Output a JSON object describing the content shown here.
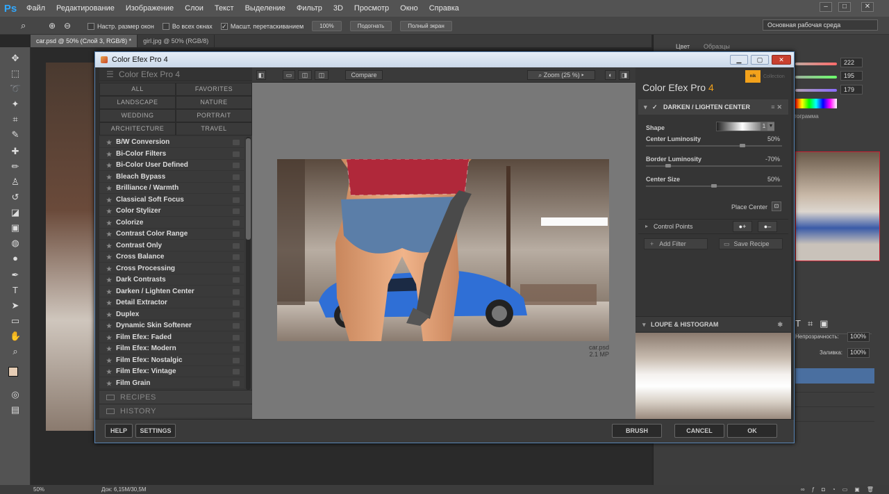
{
  "photoshop": {
    "app_logo": "Ps",
    "menu": [
      "Файл",
      "Редактирование",
      "Изображение",
      "Слои",
      "Текст",
      "Выделение",
      "Фильтр",
      "3D",
      "Просмотр",
      "Окно",
      "Справка"
    ],
    "options": {
      "resize_windows": "Настр. размер окон",
      "all_windows": "Во всех окнах",
      "scrubby_zoom": "Масшт. перетаскиванием",
      "zoom_100": "100%",
      "fit": "Подогнать",
      "fullscreen": "Полный экран",
      "workspace": "Основная рабочая среда"
    },
    "doc_tabs": [
      "car.psd @ 50% (Слой 3, RGB/8) *",
      "girl.jpg @ 50% (RGB/8)"
    ],
    "status": {
      "zoom": "50%",
      "doc": "Док: 6,15M/30,5M"
    },
    "panels": {
      "color_tab": "Цвет",
      "swatches_tab": "Образцы",
      "rgb": [
        "222",
        "195",
        "179"
      ],
      "histogram_tab": "Гистограмма",
      "opacity_label": "Непрозрачность:",
      "opacity_value": "100%",
      "fill_label": "Заливка:",
      "fill_value": "100%"
    }
  },
  "cep": {
    "window_title": "Color Efex Pro 4",
    "left": {
      "header": "Color Efex Pro 4",
      "categories": [
        "ALL",
        "FAVORITES",
        "LANDSCAPE",
        "NATURE",
        "WEDDING",
        "PORTRAIT",
        "ARCHITECTURE",
        "TRAVEL"
      ],
      "filters": [
        "B/W Conversion",
        "Bi-Color Filters",
        "Bi-Color User Defined",
        "Bleach Bypass",
        "Brilliance / Warmth",
        "Classical Soft Focus",
        "Color Stylizer",
        "Colorize",
        "Contrast Color Range",
        "Contrast Only",
        "Cross Balance",
        "Cross Processing",
        "Dark Contrasts",
        "Darken / Lighten Center",
        "Detail Extractor",
        "Duplex",
        "Dynamic Skin Softener",
        "Film Efex: Faded",
        "Film Efex: Modern",
        "Film Efex: Nostalgic",
        "Film Efex: Vintage",
        "Film Grain"
      ],
      "recipes": "RECIPES",
      "history": "HISTORY"
    },
    "center": {
      "compare": "Compare",
      "zoom": "Zoom (25 %)",
      "filename": "car.psd",
      "filesize": "2.1 MP"
    },
    "right": {
      "title": "Color Efex Pro ",
      "title_num": "4",
      "brand": "nik",
      "brand_sub": "Collection",
      "active_filter": "DARKEN / LIGHTEN CENTER",
      "shape_label": "Shape",
      "shape_value": "1",
      "controls": [
        {
          "label": "Center Luminosity",
          "value": "50%",
          "level": 0.72
        },
        {
          "label": "Border Luminosity",
          "value": "-70%",
          "level": 0.15
        },
        {
          "label": "Center Size",
          "value": "50%",
          "level": 0.5
        }
      ],
      "place_center": "Place Center",
      "control_points": "Control Points",
      "add_filter": "Add Filter",
      "save_recipe": "Save Recipe",
      "loupe": "LOUPE & HISTOGRAM"
    },
    "bottom": {
      "help": "HELP",
      "settings": "SETTINGS",
      "brush": "BRUSH",
      "cancel": "CANCEL",
      "ok": "OK"
    }
  },
  "colors": {
    "accent": "#f3a21b",
    "ps_blue": "#31a8ff",
    "title_bar": "#c9d7e8"
  }
}
